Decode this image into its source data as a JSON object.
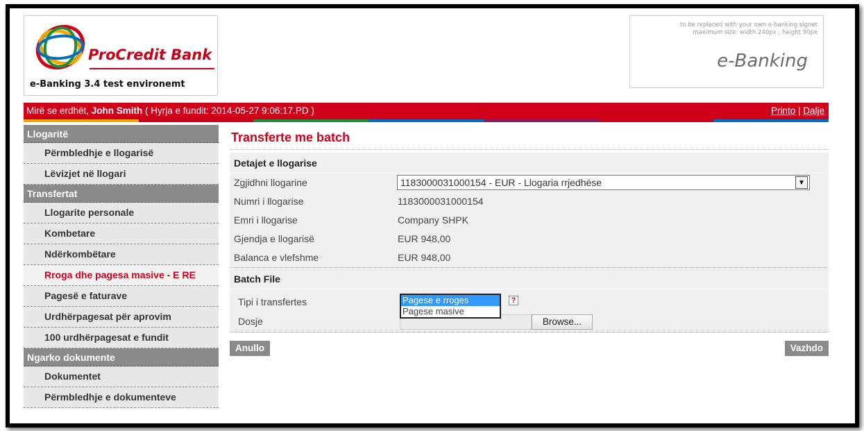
{
  "header": {
    "bank_name": "ProCredit Bank",
    "app_subtitle": "e-Banking 3.4 test environemt",
    "signet_note_line1": "to be replaced with your own e-banking signet",
    "signet_note_line2": "maximum size:  width 240px ; height 90px",
    "signet_title": "e-Banking"
  },
  "welcome_bar": {
    "greeting": "Mirë se erdhët, ",
    "user_name": "John Smith",
    "last_login": " ( Hyrja e fundit: 2014-05-27 9:06:17.PD )",
    "print_link": "Printo",
    "separator": " | ",
    "logout_link": "Dalje",
    "stripe_colors": [
      "#f5a800",
      "#d0001a",
      "#1d8f3a",
      "#0070c0",
      "#8a1b61",
      "#d0001a",
      "#0070c0"
    ]
  },
  "sidebar": {
    "sections": [
      {
        "title": "Llogaritë",
        "items": [
          {
            "label": "Përmbledhje e llogarisë"
          },
          {
            "label": "Lëvizjet në llogari"
          }
        ]
      },
      {
        "title": "Transfertat",
        "items": [
          {
            "label": "Llogarite personale"
          },
          {
            "label": "Kombetare"
          },
          {
            "label": "Ndërkombëtare"
          },
          {
            "label": "Rroga dhe pagesa masive - E RE",
            "active": true
          },
          {
            "label": "Pagesë e faturave"
          },
          {
            "label": "Urdhërpagesat për aprovim"
          },
          {
            "label": "100 urdhërpagesat e fundit"
          }
        ]
      },
      {
        "title": "Ngarko dokumente",
        "items": [
          {
            "label": "Dokumentet"
          },
          {
            "label": "Përmbledhje e dokumenteve"
          }
        ]
      }
    ]
  },
  "main": {
    "page_title": "Transferte me batch",
    "account_details": {
      "heading": "Detajet e llogarise",
      "select_label": "Zgjidhni llogarine",
      "selected_account": "1183000031000154 - EUR - Llogaria rrjedhëse",
      "rows": [
        {
          "label": "Numri i llogarise",
          "value": "1183000031000154"
        },
        {
          "label": "Emri i llogarise",
          "value": "Company SHPK"
        },
        {
          "label": "Gjendja e llogarisë",
          "value": "EUR 948,00"
        },
        {
          "label": "Balanca e vlefshme",
          "value": "EUR 948,00"
        }
      ]
    },
    "batch_file": {
      "heading": "Batch File",
      "type_label": "Tipi i transfertes",
      "type_options": [
        "Pagese e rroges",
        "Pagese masive"
      ],
      "type_selected_index": 0,
      "help_glyph": "?",
      "file_label": "Dosje",
      "browse_label": "Browse..."
    },
    "cancel_button": "Anullo",
    "continue_button": "Vazhdo"
  }
}
